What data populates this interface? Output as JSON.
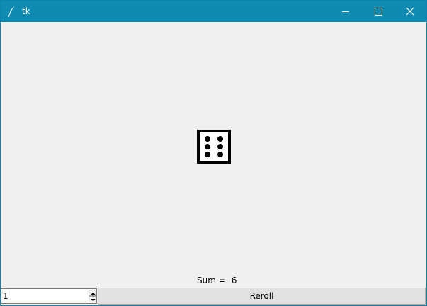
{
  "window": {
    "title": "tk",
    "accent": "#0f8ab1"
  },
  "icons": {
    "app": "tk-feather-icon",
    "minimize": "minimize-icon",
    "maximize": "maximize-icon",
    "close": "close-icon",
    "spin_up": "triangle-up-icon",
    "spin_down": "triangle-down-icon"
  },
  "dice": [
    {
      "face": 6
    }
  ],
  "sum": {
    "label": "Sum =",
    "value": "6"
  },
  "controls": {
    "count_value": "1",
    "reroll_label": "Reroll"
  }
}
